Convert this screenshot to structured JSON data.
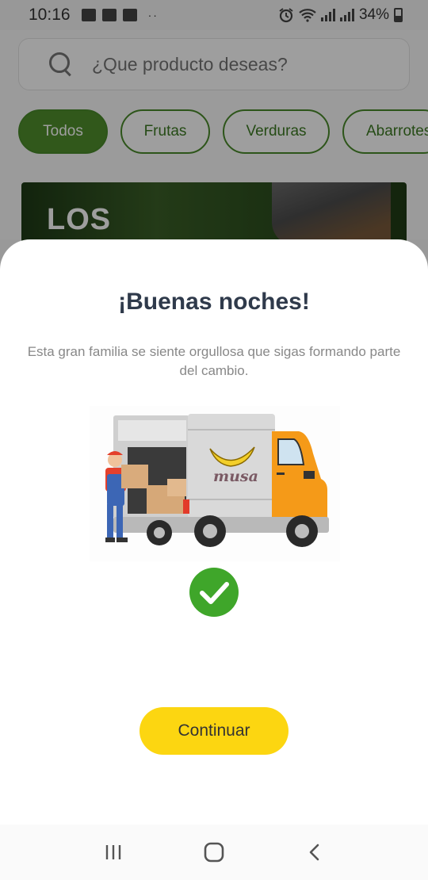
{
  "status_bar": {
    "time": "10:16",
    "battery": "34%",
    "dots": "··"
  },
  "search": {
    "placeholder": "¿Que producto deseas?"
  },
  "categories": [
    {
      "label": "Todos",
      "active": true
    },
    {
      "label": "Frutas",
      "active": false
    },
    {
      "label": "Verduras",
      "active": false
    },
    {
      "label": "Abarrotes",
      "active": false
    }
  ],
  "banner": {
    "text": "LOS"
  },
  "modal": {
    "title": "¡Buenas noches!",
    "subtitle": "Esta gran familia se siente orgullosa que sigas formando parte del cambio.",
    "truck_brand": "musa",
    "continue_label": "Continuar"
  },
  "colors": {
    "accent_green": "#4f8f2c",
    "check_green": "#3fa62a",
    "button_yellow": "#fcd611",
    "title_dark": "#2f3a4b"
  },
  "icons": [
    "search-icon",
    "check-circle-icon",
    "recent-apps-icon",
    "home-icon",
    "back-icon",
    "alarm-icon",
    "wifi-icon",
    "signal-icon",
    "battery-icon"
  ]
}
